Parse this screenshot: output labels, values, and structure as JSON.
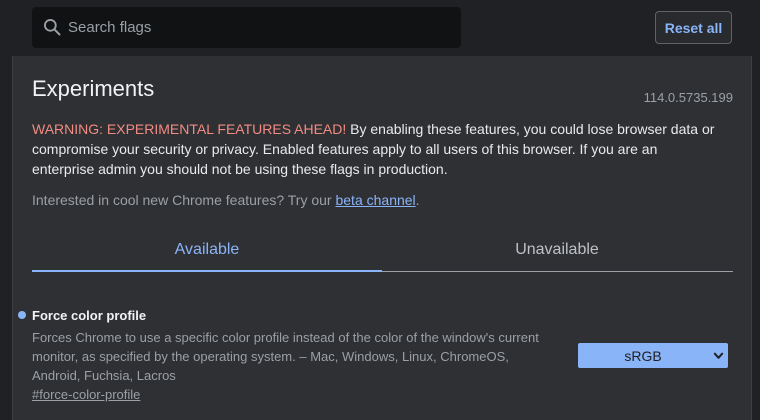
{
  "search": {
    "placeholder": "Search flags",
    "value": ""
  },
  "toolbar": {
    "reset_label": "Reset all"
  },
  "header": {
    "title": "Experiments",
    "version": "114.0.5735.199"
  },
  "warning": {
    "heading": "WARNING: EXPERIMENTAL FEATURES AHEAD!",
    "body": " By enabling these features, you could lose browser data or compromise your security or privacy. Enabled features apply to all users of this browser. If you are an enterprise admin you should not be using these flags in production."
  },
  "interested": {
    "prefix": "Interested in cool new Chrome features? Try our ",
    "link": "beta channel",
    "suffix": "."
  },
  "tabs": [
    {
      "label": "Available",
      "active": true
    },
    {
      "label": "Unavailable",
      "active": false
    }
  ],
  "flags": [
    {
      "name": "Force color profile",
      "description": "Forces Chrome to use a specific color profile instead of the color of the window's current monitor, as specified by the operating system. – Mac, Windows, Linux, ChromeOS, Android, Fuchsia, Lacros",
      "link": "#force-color-profile",
      "selected": "sRGB"
    }
  ],
  "colors": {
    "background": "#202124",
    "panel": "#2f3034",
    "accent": "#8ab4f8",
    "warning": "#f28b82",
    "text_secondary": "#9aa0a6"
  }
}
